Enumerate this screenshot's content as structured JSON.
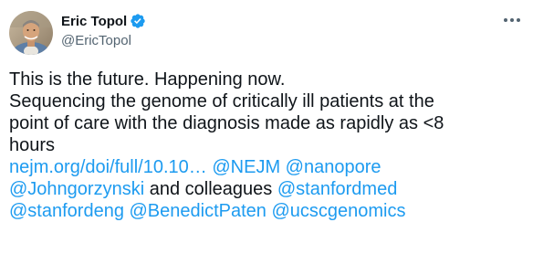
{
  "author": {
    "display_name": "Eric Topol",
    "handle": "@EricTopol"
  },
  "icons": {
    "verified": "verified-badge-icon",
    "more": "more-options-icon"
  },
  "colors": {
    "link": "#1d9bf0",
    "verified": "#1d9bf0",
    "text": "#0f1419",
    "secondary": "#536471"
  },
  "tweet": {
    "line1": "This is the future. Happening now.",
    "line2": "Sequencing the genome of critically ill patients at the",
    "line3": "point of care with the diagnosis made as rapidly as <8",
    "line4": "hours",
    "link_url": "nejm.org/doi/full/10.10…",
    "mention_nejm": "@NEJM",
    "mention_nanopore": "@nanopore",
    "mention_johngorzynski": "@Johngorzynski",
    "and_colleagues": "and colleagues",
    "mention_stanfordmed": "@stanfordmed",
    "mention_stanfordeng": "@stanfordeng",
    "mention_benedictpaten": "@BenedictPaten",
    "mention_ucscgenomics": "@ucscgenomics"
  }
}
